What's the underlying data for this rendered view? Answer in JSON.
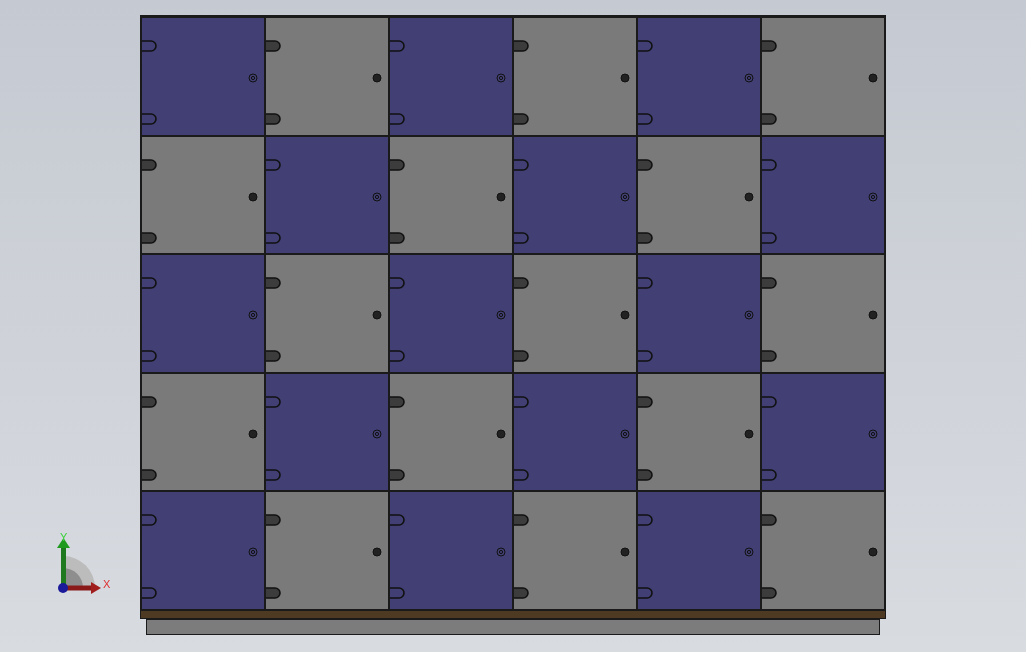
{
  "locker": {
    "rows": [
      {
        "doors": [
          {
            "color": "#413f74",
            "kind": "outline"
          },
          {
            "color": "#7a7a7a",
            "kind": "solid"
          },
          {
            "color": "#413f74",
            "kind": "outline"
          },
          {
            "color": "#7a7a7a",
            "kind": "solid"
          },
          {
            "color": "#413f74",
            "kind": "outline"
          },
          {
            "color": "#7a7a7a",
            "kind": "solid"
          }
        ]
      },
      {
        "doors": [
          {
            "color": "#7a7a7a",
            "kind": "solid"
          },
          {
            "color": "#413f74",
            "kind": "outline"
          },
          {
            "color": "#7a7a7a",
            "kind": "solid"
          },
          {
            "color": "#413f74",
            "kind": "outline"
          },
          {
            "color": "#7a7a7a",
            "kind": "solid"
          },
          {
            "color": "#413f74",
            "kind": "outline"
          }
        ]
      },
      {
        "doors": [
          {
            "color": "#413f74",
            "kind": "outline"
          },
          {
            "color": "#7a7a7a",
            "kind": "solid"
          },
          {
            "color": "#413f74",
            "kind": "outline"
          },
          {
            "color": "#7a7a7a",
            "kind": "solid"
          },
          {
            "color": "#413f74",
            "kind": "outline"
          },
          {
            "color": "#7a7a7a",
            "kind": "solid"
          }
        ]
      },
      {
        "doors": [
          {
            "color": "#7a7a7a",
            "kind": "solid"
          },
          {
            "color": "#413f74",
            "kind": "outline"
          },
          {
            "color": "#7a7a7a",
            "kind": "solid"
          },
          {
            "color": "#413f74",
            "kind": "outline"
          },
          {
            "color": "#7a7a7a",
            "kind": "solid"
          },
          {
            "color": "#413f74",
            "kind": "outline"
          }
        ]
      },
      {
        "doors": [
          {
            "color": "#413f74",
            "kind": "outline"
          },
          {
            "color": "#7a7a7a",
            "kind": "solid"
          },
          {
            "color": "#413f74",
            "kind": "outline"
          },
          {
            "color": "#7a7a7a",
            "kind": "solid"
          },
          {
            "color": "#413f74",
            "kind": "outline"
          },
          {
            "color": "#7a7a7a",
            "kind": "solid"
          }
        ]
      }
    ]
  },
  "triad": {
    "y_label": "Y",
    "x_label": "X"
  }
}
